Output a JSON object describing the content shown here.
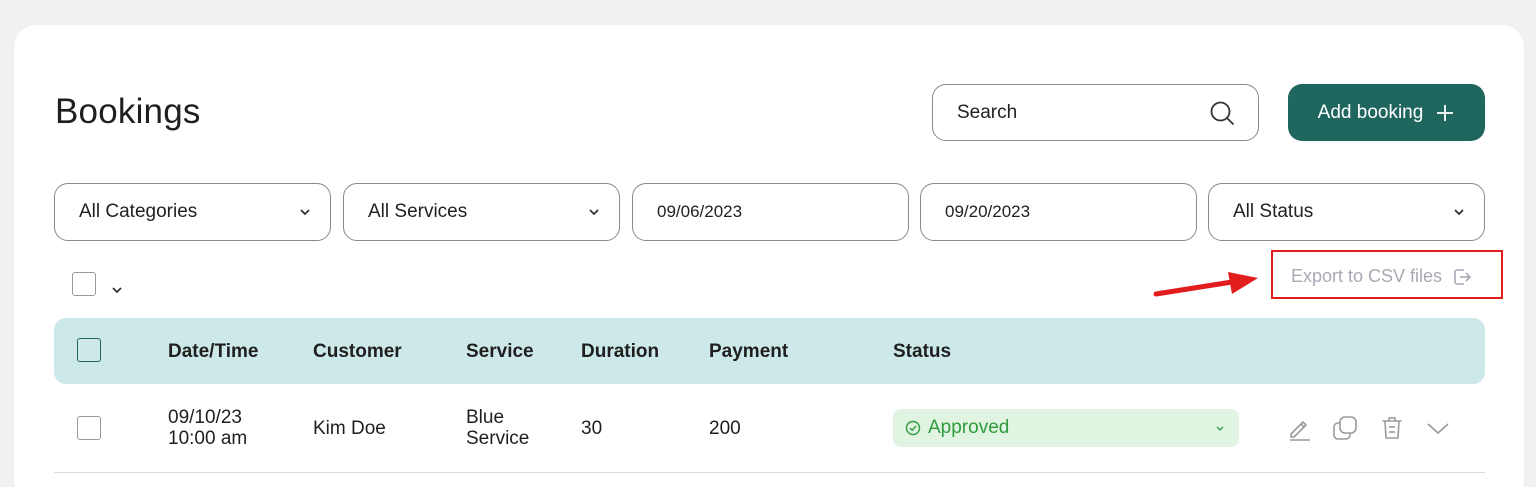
{
  "page": {
    "title": "Bookings"
  },
  "search": {
    "placeholder": "Search"
  },
  "add_button": {
    "label": "Add booking"
  },
  "filters": {
    "category": "All Categories",
    "service": "All Services",
    "date_from": "09/06/2023",
    "date_to": "09/20/2023",
    "status": "All Status"
  },
  "export": {
    "label": "Export to CSV files"
  },
  "table": {
    "headers": [
      "Date/Time",
      "Customer",
      "Service",
      "Duration",
      "Payment",
      "Status"
    ],
    "rows": [
      {
        "date": "09/10/23",
        "time": "10:00 am",
        "customer": "Kim Doe",
        "service_line1": "Blue",
        "service_line2": "Service",
        "duration": "30",
        "payment": "200",
        "status": "Approved"
      }
    ]
  },
  "colors": {
    "primary": "#1f675e",
    "header_bg": "#cde8e8",
    "status_bg": "#e1f4e1",
    "status_text": "#2e9b3e",
    "annotation": "#e21d1d"
  },
  "icons": {
    "search": "search-icon",
    "add": "plus-icon",
    "dropdown": "chevron-down-icon",
    "export": "export-icon",
    "status": "check-circle-icon",
    "edit": "pencil-icon",
    "duplicate": "duplicate-icon",
    "delete": "trash-icon",
    "expand": "chevron-down-icon"
  }
}
